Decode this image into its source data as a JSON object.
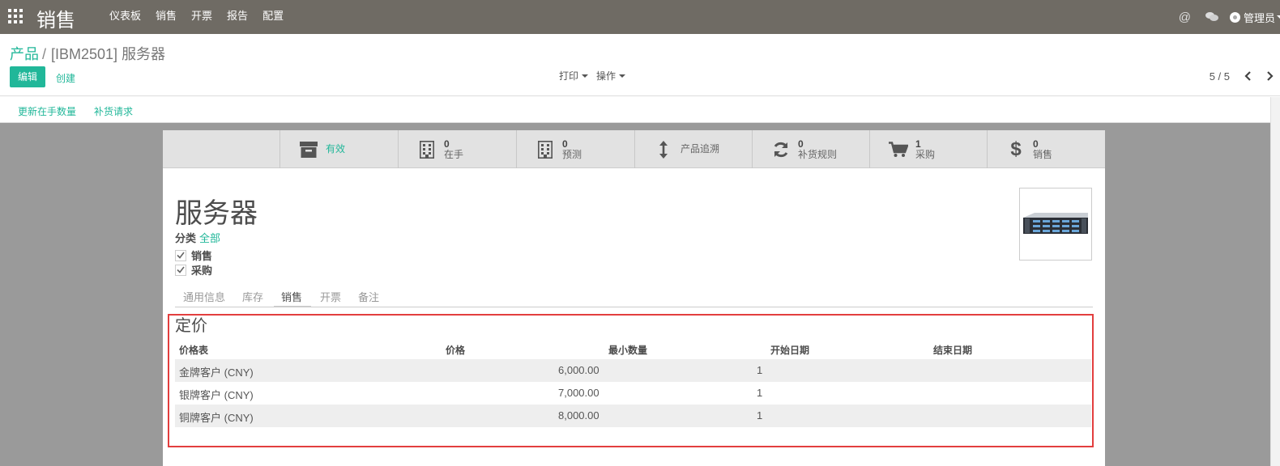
{
  "navbar": {
    "brand": "销售",
    "menu": [
      "仪表板",
      "销售",
      "开票",
      "报告",
      "配置"
    ],
    "user": "管理员"
  },
  "breadcrumb": {
    "parent": "产品",
    "separator": "/",
    "current": "[IBM2501] 服务器"
  },
  "buttons": {
    "edit": "编辑",
    "create": "创建"
  },
  "sidebar": {
    "print": "打印",
    "action": "操作"
  },
  "pager": {
    "value": "5 / 5"
  },
  "actionbar": {
    "update_qty": "更新在手数量",
    "replenish": "补货请求"
  },
  "stats": {
    "active": "有效",
    "onhand": {
      "num": "0",
      "label": "在手"
    },
    "forecast": {
      "num": "0",
      "label": "预测"
    },
    "traceability": "产品追溯",
    "reorder": {
      "num": "0",
      "label": "补货规则"
    },
    "purchase": {
      "num": "1",
      "label": "采购"
    },
    "sales": {
      "num": "0",
      "label": "销售"
    }
  },
  "product": {
    "name": "服务器",
    "category_label": "分类",
    "category_value": "全部",
    "sale_ok": "销售",
    "purchase_ok": "采购"
  },
  "tabs": [
    "通用信息",
    "库存",
    "销售",
    "开票",
    "备注"
  ],
  "pricing": {
    "title": "定价",
    "columns": [
      "价格表",
      "价格",
      "最小数量",
      "开始日期",
      "结束日期"
    ],
    "rows": [
      {
        "pricelist": "金牌客户 (CNY)",
        "price": "6,000.00",
        "min_qty": "1"
      },
      {
        "pricelist": "银牌客户 (CNY)",
        "price": "7,000.00",
        "min_qty": "1"
      },
      {
        "pricelist": "铜牌客户 (CNY)",
        "price": "8,000.00",
        "min_qty": "1"
      }
    ]
  },
  "colors": {
    "primary": "#21b799",
    "navbar": "#6f6b64",
    "highlight": "#e33e3e"
  }
}
